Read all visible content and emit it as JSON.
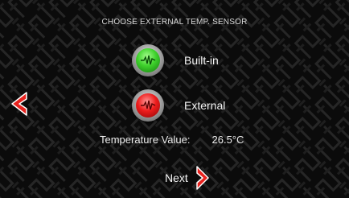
{
  "header": {
    "title": "CHOOSE EXTERNAL TEMP. SENSOR"
  },
  "options": [
    {
      "label": "Built-in",
      "indicator_color": "#3ed12b",
      "icon": "waveform-icon"
    },
    {
      "label": "External",
      "indicator_color": "#ee1c1c",
      "icon": "waveform-icon"
    }
  ],
  "temperature": {
    "label": "Temperature Value:",
    "value": "26.5°C"
  },
  "navigation": {
    "back_icon": "chevron-left-icon",
    "next_label": "Next",
    "next_icon": "chevron-right-icon"
  },
  "colors": {
    "background": "#0b0b0b",
    "accent_arrow": "#e8231f",
    "text": "#f4f4f4"
  }
}
